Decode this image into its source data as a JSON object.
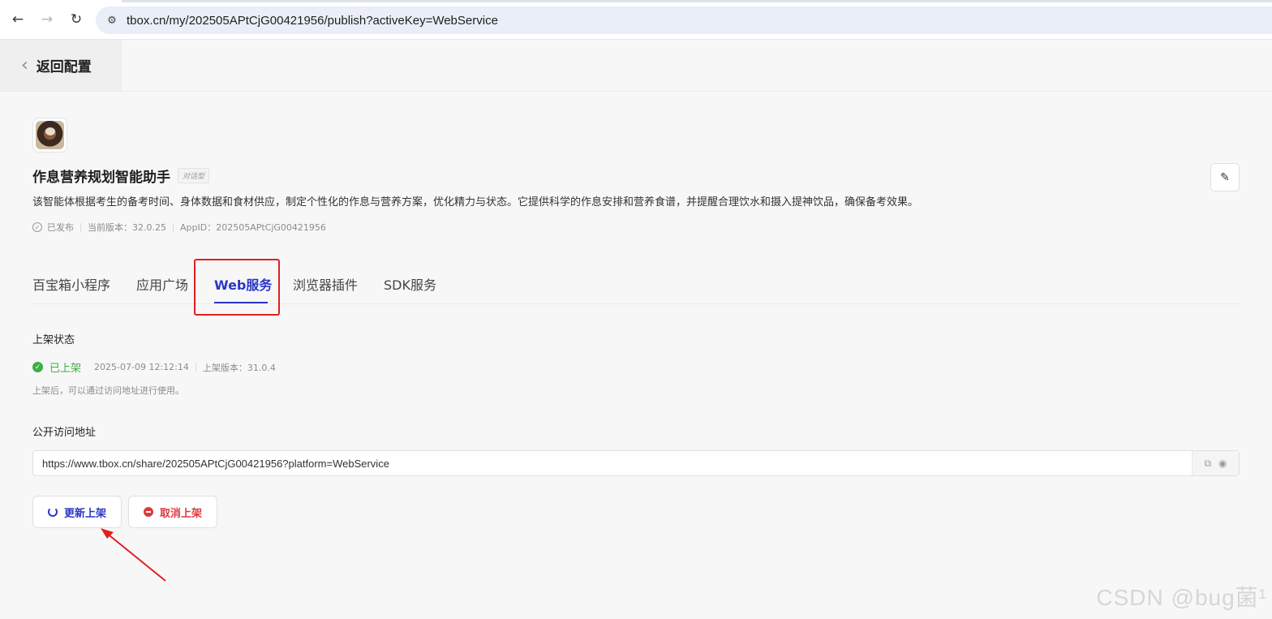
{
  "browser": {
    "url": "tbox.cn/my/202505APtCjG00421956/publish?activeKey=WebService"
  },
  "header": {
    "back_label": "返回配置"
  },
  "app": {
    "name": "作息营养规划智能助手",
    "type_tag": "对话型",
    "description": "该智能体根据考生的备考时间、身体数据和食材供应，制定个性化的作息与营养方案，优化精力与状态。它提供科学的作息安排和营养食谱，并提醒合理饮水和摄入提神饮品，确保备考效果。",
    "status": "已发布",
    "version": "当前版本：32.0.25",
    "app_id": "AppID：202505APtCjG00421956"
  },
  "tabs": [
    {
      "label": "百宝箱小程序"
    },
    {
      "label": "应用广场"
    },
    {
      "label": "Web服务"
    },
    {
      "label": "浏览器插件"
    },
    {
      "label": "SDK服务"
    }
  ],
  "active_tab": "Web服务",
  "listing": {
    "section_title": "上架状态",
    "status_text": "已上架",
    "time": "2025-07-09 12:12:14",
    "listed_version": "上架版本：31.0.4",
    "hint": "上架后，可以通过访问地址进行使用。"
  },
  "public_url": {
    "section_title": "公开访问地址",
    "value": "https://www.tbox.cn/share/202505APtCjG00421956?platform=WebService"
  },
  "buttons": {
    "update": "更新上架",
    "cancel": "取消上架"
  },
  "colors": {
    "accent": "#2b36c7",
    "success": "#3cb043",
    "danger": "#e0393e",
    "highlight": "#e02020"
  },
  "watermark": "CSDN @bug菌¹"
}
